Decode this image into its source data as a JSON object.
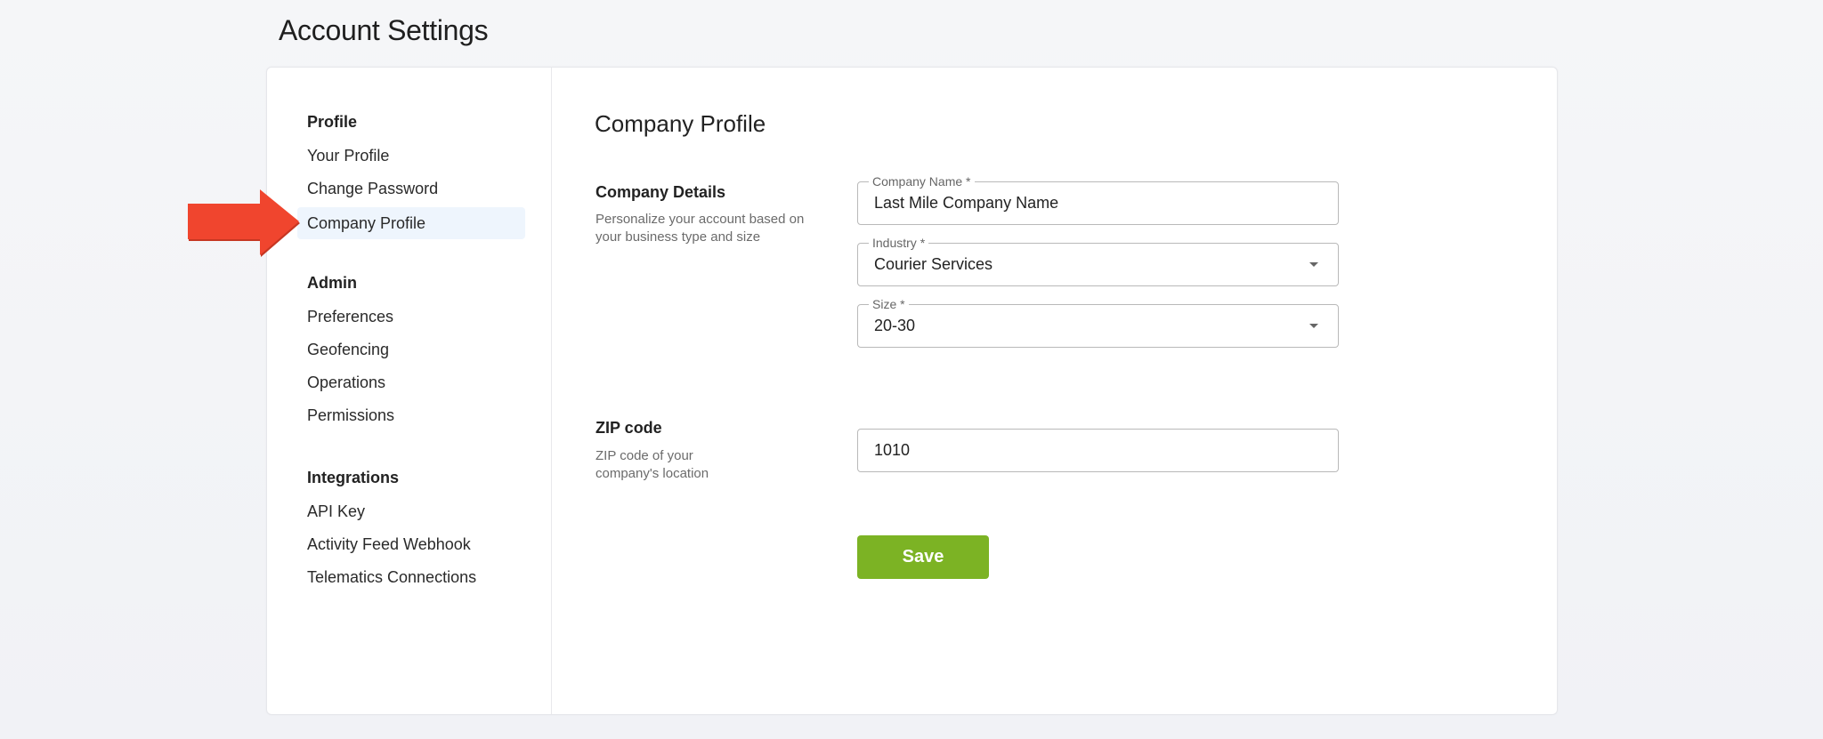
{
  "page": {
    "title": "Account Settings"
  },
  "sidebar": {
    "groups": [
      {
        "title": "Profile",
        "items": [
          {
            "label": "Your Profile",
            "active": false
          },
          {
            "label": "Change Password",
            "active": false
          },
          {
            "label": "Company Profile",
            "active": true
          }
        ]
      },
      {
        "title": "Admin",
        "items": [
          {
            "label": "Preferences",
            "active": false
          },
          {
            "label": "Geofencing",
            "active": false
          },
          {
            "label": "Operations",
            "active": false
          },
          {
            "label": "Permissions",
            "active": false
          }
        ]
      },
      {
        "title": "Integrations",
        "items": [
          {
            "label": "API Key",
            "active": false
          },
          {
            "label": "Activity Feed Webhook",
            "active": false
          },
          {
            "label": "Telematics Connections",
            "active": false
          }
        ]
      }
    ]
  },
  "content": {
    "title": "Company Profile",
    "company_details": {
      "title": "Company Details",
      "description": "Personalize your account based on your business type and size",
      "fields": {
        "company_name": {
          "label": "Company Name *",
          "value": "Last Mile Company Name"
        },
        "industry": {
          "label": "Industry *",
          "value": "Courier Services"
        },
        "size": {
          "label": "Size *",
          "value": "20-30"
        }
      }
    },
    "zip": {
      "title": "ZIP code",
      "description": "ZIP code of your company's location",
      "value": "1010"
    },
    "save_label": "Save"
  },
  "annotation": {
    "type": "arrow-right",
    "color": "#f0452e",
    "points_to": "Company Profile"
  }
}
